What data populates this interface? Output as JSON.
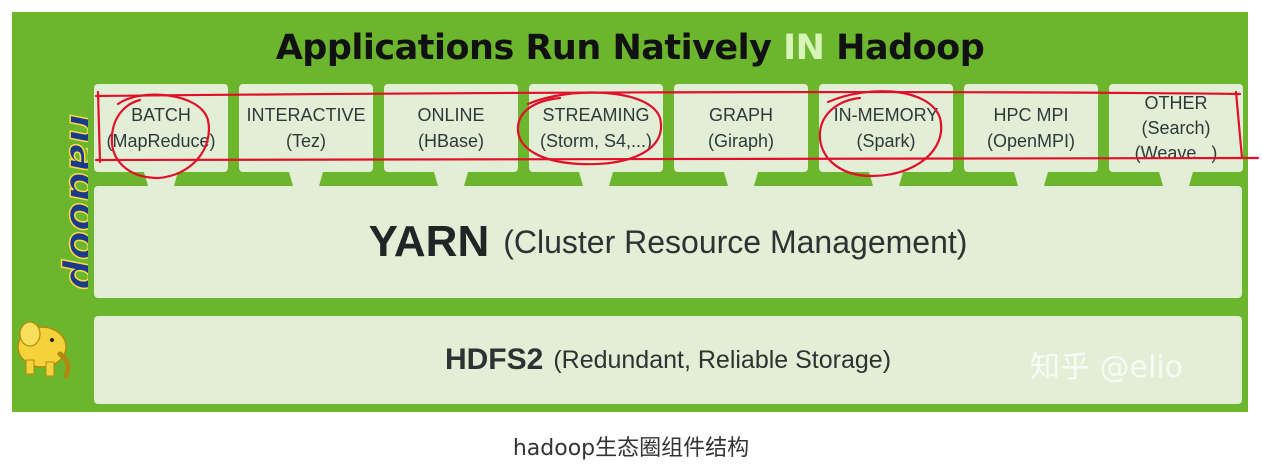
{
  "diagram": {
    "title_prefix": "Applications Run Natively ",
    "title_highlight": "IN",
    "title_suffix": " Hadoop",
    "apps": [
      {
        "name": "BATCH",
        "detail": "(MapReduce)"
      },
      {
        "name": "INTERACTIVE",
        "detail": "(Tez)"
      },
      {
        "name": "ONLINE",
        "detail": "(HBase)"
      },
      {
        "name": "STREAMING",
        "detail": "(Storm, S4,...)"
      },
      {
        "name": "GRAPH",
        "detail": "(Giraph)"
      },
      {
        "name": "IN-MEMORY",
        "detail": "(Spark)"
      },
      {
        "name": "HPC MPI",
        "detail": "(OpenMPI)"
      },
      {
        "name": "OTHER",
        "detail": "(Search)",
        "detail2": "(Weave...)"
      }
    ],
    "yarn": {
      "name": "YARN",
      "detail": "(Cluster Resource Management)"
    },
    "hdfs": {
      "name": "HDFS2",
      "detail": "(Redundant, Reliable Storage)"
    },
    "logo_text": "hadoop",
    "watermark": "知乎 @elio",
    "colors": {
      "background": "#6bb62c",
      "box": "#e3eed6",
      "highlight": "#d8f4b8",
      "annotation": "#e0102a"
    }
  },
  "caption": "hadoop生态圈组件结构"
}
